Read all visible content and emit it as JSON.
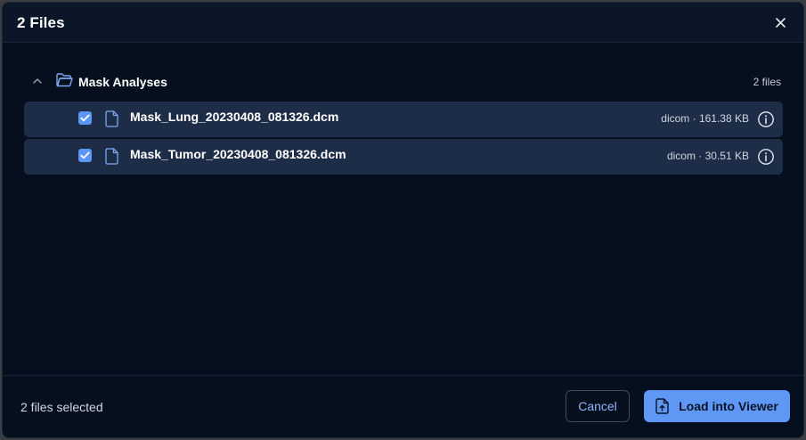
{
  "dialog": {
    "title": "2 Files"
  },
  "group": {
    "name": "Mask Analyses",
    "count": "2 files",
    "expanded": true
  },
  "files": [
    {
      "name": "Mask_Lung_20230408_081326.dcm",
      "meta": "dicom · 161.38 KB",
      "checked": true
    },
    {
      "name": "Mask_Tumor_20230408_081326.dcm",
      "meta": "dicom · 30.51 KB",
      "checked": true
    }
  ],
  "footer": {
    "selected": "2 files selected",
    "cancel_label": "Cancel",
    "load_label": "Load into Viewer"
  },
  "icons": {
    "close": "close-icon",
    "chevron": "chevron-up-icon",
    "folder": "folder-open-icon",
    "file": "file-icon",
    "info": "info-icon",
    "load": "file-upload-icon",
    "check": "checkmark-icon"
  },
  "colors": {
    "accent": "#5e98f4",
    "background": "#050f1d",
    "row": "#1d2d48",
    "header": "#0b1729"
  }
}
